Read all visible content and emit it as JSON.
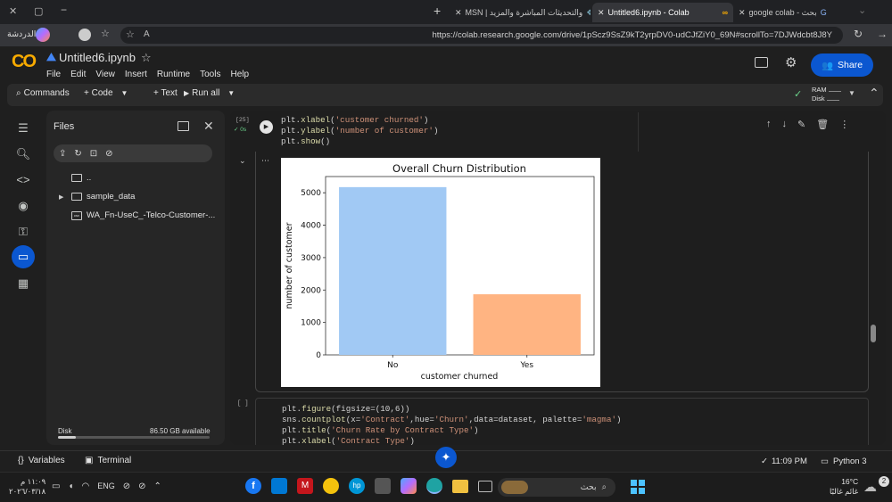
{
  "browser": {
    "tabs": [
      {
        "label": "MSN | والتحديثات المباشرة والمزيد",
        "active": false
      },
      {
        "label": "Untitled6.ipynb - Colab",
        "active": true
      },
      {
        "label": "google colab - بحث",
        "active": false
      }
    ],
    "profile_label": "الدردشة",
    "url": "https://colab.research.google.com/drive/1pScz9SsZ9kT2yrpDV0-udCJfZiY0_69N#scrollTo=7DJWdcbt8J8Y"
  },
  "colab": {
    "logo": "CO",
    "notebook_title": "Untitled6.ipynb",
    "menu": [
      "File",
      "Edit",
      "View",
      "Insert",
      "Runtime",
      "Tools",
      "Help"
    ],
    "share_label": "Share",
    "toolbar": {
      "commands": "Commands",
      "code": "+ Code",
      "text": "+ Text",
      "run_all": "Run all",
      "ram": "RAM",
      "disk": "Disk"
    }
  },
  "files_panel": {
    "title": "Files",
    "items": [
      {
        "name": "..",
        "type": "folder",
        "expandable": false
      },
      {
        "name": "sample_data",
        "type": "folder",
        "expandable": true
      },
      {
        "name": "WA_Fn-UseC_-Telco-Customer-...",
        "type": "csv",
        "expandable": false
      }
    ],
    "disk_label": "Disk",
    "disk_available": "86.50 GB available",
    "disk_used_fraction": 0.12
  },
  "cells": {
    "cell1": {
      "exec_count": "[25]",
      "status": "0s",
      "code_lines": [
        [
          {
            "t": "plt.",
            "c": "p"
          },
          {
            "t": "xlabel",
            "c": "f"
          },
          {
            "t": "(",
            "c": "p"
          },
          {
            "t": "'customer churned'",
            "c": "s"
          },
          {
            "t": ")",
            "c": "p"
          }
        ],
        [
          {
            "t": "plt.",
            "c": "p"
          },
          {
            "t": "ylabel",
            "c": "f"
          },
          {
            "t": "(",
            "c": "p"
          },
          {
            "t": "'number of customer'",
            "c": "s"
          },
          {
            "t": ")",
            "c": "p"
          }
        ],
        [
          {
            "t": "plt.",
            "c": "p"
          },
          {
            "t": "show",
            "c": "f"
          },
          {
            "t": "()",
            "c": "p"
          }
        ]
      ]
    },
    "cell2": {
      "exec_count": "[ ]",
      "code_lines": [
        [
          {
            "t": "plt.",
            "c": "p"
          },
          {
            "t": "figure",
            "c": "f"
          },
          {
            "t": "(figsize=(10,6))",
            "c": "p"
          }
        ],
        [
          {
            "t": "sns.",
            "c": "p"
          },
          {
            "t": "countplot",
            "c": "f"
          },
          {
            "t": "(x=",
            "c": "p"
          },
          {
            "t": "'Contract'",
            "c": "s"
          },
          {
            "t": ",hue=",
            "c": "p"
          },
          {
            "t": "'Churn'",
            "c": "s"
          },
          {
            "t": ",data=dataset, palette=",
            "c": "p"
          },
          {
            "t": "'magma'",
            "c": "s"
          },
          {
            "t": ")",
            "c": "p"
          }
        ],
        [
          {
            "t": "plt.",
            "c": "p"
          },
          {
            "t": "title",
            "c": "f"
          },
          {
            "t": "(",
            "c": "p"
          },
          {
            "t": "'Churn Rate by Contract Type'",
            "c": "s"
          },
          {
            "t": ")",
            "c": "p"
          }
        ],
        [
          {
            "t": "plt.",
            "c": "p"
          },
          {
            "t": "xlabel",
            "c": "f"
          },
          {
            "t": "(",
            "c": "p"
          },
          {
            "t": "'Contract Type'",
            "c": "s"
          },
          {
            "t": ")",
            "c": "p"
          }
        ]
      ]
    }
  },
  "chart_data": {
    "type": "bar",
    "title": "Overall Churn Distribution",
    "xlabel": "customer churned",
    "ylabel": "number of customer",
    "categories": [
      "No",
      "Yes"
    ],
    "values": [
      5174,
      1869
    ],
    "colors": [
      "#a1c9f4",
      "#ffb482"
    ],
    "ylim": [
      0,
      5500
    ],
    "yticks": [
      0,
      1000,
      2000,
      3000,
      4000,
      5000
    ],
    "grid": false
  },
  "statusbar": {
    "variables": "Variables",
    "terminal": "Terminal",
    "time": "11:09 PM",
    "runtime": "Python 3"
  },
  "taskbar": {
    "search": "بحث",
    "weather_temp": "16°C",
    "weather_label": "غائم غالبًا",
    "lang": "ENG",
    "clock_time": "١١:٠٩ م",
    "clock_date": "٢٠٢٦/٠٣/١٨",
    "notif_count": "2"
  }
}
